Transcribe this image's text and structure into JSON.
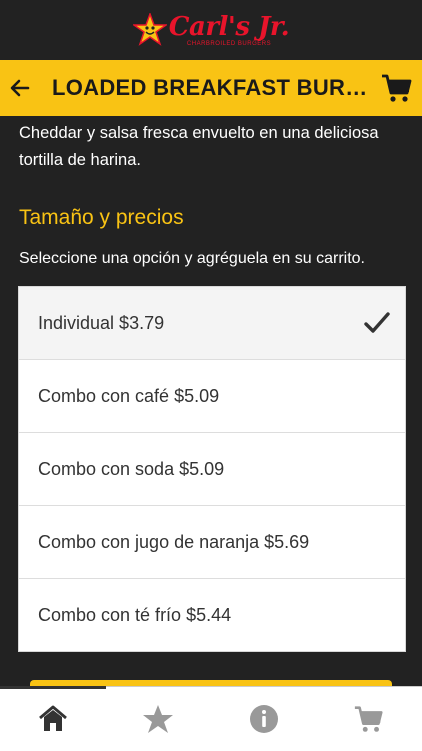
{
  "brand": {
    "name": "Carl's Jr.",
    "tagline": "CHARBROILED BURGERS"
  },
  "header": {
    "title": "LOADED BREAKFAST BURRI…"
  },
  "product": {
    "description": "tocino, hash brown, mezcla de quesos Jack y Cheddar y salsa fresca envuelto en una deliciosa tortilla de harina."
  },
  "pricing": {
    "section_title": "Tamaño y precios",
    "instruction": "Seleccione una opción y agréguela en su carrito.",
    "options": [
      {
        "label": "Individual $3.79",
        "selected": true
      },
      {
        "label": "Combo con café $5.09",
        "selected": false
      },
      {
        "label": "Combo con soda $5.09",
        "selected": false
      },
      {
        "label": "Combo con jugo de naranja $5.69",
        "selected": false
      },
      {
        "label": "Combo con té frío $5.44",
        "selected": false
      }
    ]
  },
  "nav": {
    "items": [
      {
        "icon": "home-icon",
        "active": true
      },
      {
        "icon": "star-icon",
        "active": false
      },
      {
        "icon": "info-icon",
        "active": false
      },
      {
        "icon": "cart-icon",
        "active": false
      }
    ]
  },
  "colors": {
    "accent": "#f9c314",
    "background": "#222222",
    "brand_red": "#e8142b"
  }
}
